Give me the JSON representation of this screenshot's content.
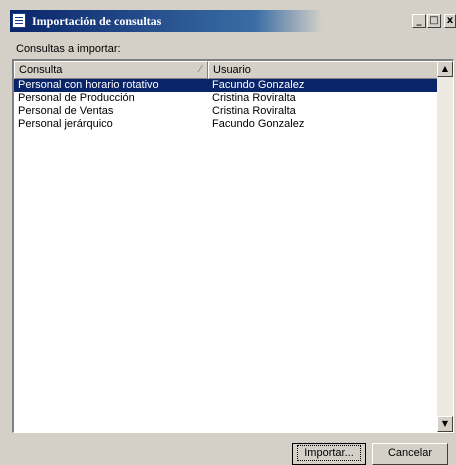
{
  "window": {
    "title": "Importación de consultas",
    "controls": {
      "minimize": "_",
      "maximize": "□",
      "close": "x"
    }
  },
  "section_label": "Consultas a importar:",
  "table": {
    "columns": [
      "Consulta",
      "Usuario"
    ],
    "sorted_column": "Consulta",
    "rows": [
      {
        "consulta": "Personal con horario rotativo",
        "usuario": "Facundo Gonzalez",
        "selected": true
      },
      {
        "consulta": "Personal de Producción",
        "usuario": "Cristina Roviralta",
        "selected": false
      },
      {
        "consulta": "Personal de Ventas",
        "usuario": "Cristina Roviralta",
        "selected": false
      },
      {
        "consulta": "Personal jerárquico",
        "usuario": "Facundo Gonzalez",
        "selected": false
      }
    ]
  },
  "buttons": {
    "import": "Importar...",
    "cancel": "Cancelar"
  },
  "colors": {
    "title_bar": "#0a246a",
    "selection": "#0a246a",
    "face": "#d4d0c8"
  },
  "icons": {
    "sort": "sort-indicator-icon",
    "scroll_up": "arrow-up-icon",
    "scroll_down": "arrow-down-icon"
  }
}
